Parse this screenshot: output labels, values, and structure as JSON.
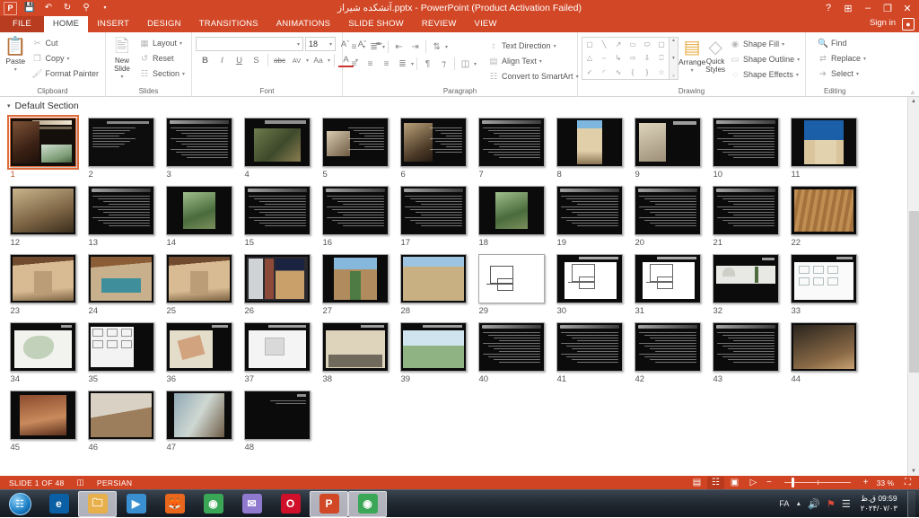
{
  "titlebar": {
    "app_icon": "powerpoint-icon",
    "quick_access": [
      {
        "name": "save-icon",
        "glyph": "💾"
      },
      {
        "name": "undo-icon",
        "glyph": "↶"
      },
      {
        "name": "redo-icon",
        "glyph": "↻"
      },
      {
        "name": "start-slideshow-icon",
        "glyph": "⛶"
      },
      {
        "name": "customize-qat-icon",
        "glyph": "▾"
      }
    ],
    "document_title": "آتشکده شیراز.pptx  -  PowerPoint (Product Activation Failed)",
    "window_controls": [
      {
        "name": "help-button",
        "glyph": "?"
      },
      {
        "name": "ribbon-display-options-button",
        "glyph": "⊞"
      },
      {
        "name": "minimize-button",
        "glyph": "–"
      },
      {
        "name": "restore-button",
        "glyph": "❐"
      },
      {
        "name": "close-button",
        "glyph": "✕"
      }
    ],
    "sign_in": "Sign in",
    "account_icon": "user-account-icon"
  },
  "tabs": [
    {
      "label": "FILE",
      "active": false,
      "file": true
    },
    {
      "label": "HOME",
      "active": true,
      "file": false
    },
    {
      "label": "INSERT",
      "active": false,
      "file": false
    },
    {
      "label": "DESIGN",
      "active": false,
      "file": false
    },
    {
      "label": "TRANSITIONS",
      "active": false,
      "file": false
    },
    {
      "label": "ANIMATIONS",
      "active": false,
      "file": false
    },
    {
      "label": "SLIDE SHOW",
      "active": false,
      "file": false
    },
    {
      "label": "REVIEW",
      "active": false,
      "file": false
    },
    {
      "label": "VIEW",
      "active": false,
      "file": false
    }
  ],
  "ribbon": {
    "clipboard": {
      "title": "Clipboard",
      "paste_label": "Paste",
      "items": [
        {
          "label": "Cut",
          "icon": "scissors-icon"
        },
        {
          "label": "Copy",
          "icon": "copy-icon"
        },
        {
          "label": "Format Painter",
          "icon": "format-painter-icon"
        }
      ]
    },
    "slides": {
      "title": "Slides",
      "new_slide_label": "New Slide",
      "items": [
        {
          "label": "Layout",
          "icon": "layout-icon"
        },
        {
          "label": "Reset",
          "icon": "reset-icon"
        },
        {
          "label": "Section",
          "icon": "section-icon"
        }
      ]
    },
    "font": {
      "title": "Font",
      "font_name_value": "",
      "font_name_placeholder": "",
      "font_size_value": "18",
      "buttons": [
        {
          "name": "increase-font-size-button",
          "label": "A˄"
        },
        {
          "name": "decrease-font-size-button",
          "label": "A˅"
        },
        {
          "name": "clear-formatting-button",
          "label": "✐"
        },
        {
          "name": "bold-button",
          "label": "B"
        },
        {
          "name": "italic-button",
          "label": "I"
        },
        {
          "name": "underline-button",
          "label": "U"
        },
        {
          "name": "text-shadow-button",
          "label": "S"
        },
        {
          "name": "strikethrough-button",
          "label": "abc"
        },
        {
          "name": "character-spacing-button",
          "label": "AV"
        },
        {
          "name": "change-case-button",
          "label": "Aa"
        },
        {
          "name": "font-color-button",
          "label": "A"
        }
      ]
    },
    "paragraph": {
      "title": "Paragraph",
      "items": [
        {
          "label": "Text Direction",
          "icon": "text-direction-icon"
        },
        {
          "label": "Align Text",
          "icon": "align-text-icon"
        },
        {
          "label": "Convert to SmartArt",
          "icon": "smartart-icon"
        }
      ],
      "row1": [
        "bullets-icon",
        "numbering-icon",
        "decrease-indent-icon",
        "increase-indent-icon",
        "line-spacing-icon"
      ],
      "row2": [
        "align-left-icon",
        "align-center-icon",
        "align-right-icon",
        "justify-icon",
        "rtl-direction-icon",
        "ltr-direction-icon",
        "columns-icon"
      ]
    },
    "drawing": {
      "title": "Drawing",
      "arrange_label": "Arrange",
      "quick_styles_label": "Quick Styles",
      "items": [
        {
          "label": "Shape Fill",
          "icon": "shape-fill-icon"
        },
        {
          "label": "Shape Outline",
          "icon": "shape-outline-icon"
        },
        {
          "label": "Shape Effects",
          "icon": "shape-effects-icon"
        }
      ],
      "shapes": [
        "▢",
        "╲",
        "↗",
        "▭",
        "⬭",
        "▢",
        "△",
        "⌐",
        "↳",
        "⇨",
        "⇩",
        "⌐",
        "⌘",
        "◜",
        "∿",
        "{",
        "}",
        "☆"
      ]
    },
    "editing": {
      "title": "Editing",
      "items": [
        {
          "label": "Find",
          "icon": "binoculars-icon"
        },
        {
          "label": "Replace",
          "icon": "replace-icon"
        },
        {
          "label": "Select",
          "icon": "select-cursor-icon"
        }
      ],
      "collapse_icon": "collapse-ribbon-icon"
    }
  },
  "sorter": {
    "section_name": "Default Section",
    "expand_icon": "triangle-collapse-icon",
    "selected_slide": 1,
    "slides": [
      {
        "n": 1,
        "kind": "title-image",
        "bg": "#1a1410"
      },
      {
        "n": 2,
        "kind": "text-left",
        "bg": "#0d0d0d"
      },
      {
        "n": 3,
        "kind": "text",
        "bg": "#0b0b0b"
      },
      {
        "n": 4,
        "kind": "image-mid",
        "bg": "#0b0b0b"
      },
      {
        "n": 5,
        "kind": "text-image",
        "bg": "#0b0b0b"
      },
      {
        "n": 6,
        "kind": "image-text",
        "bg": "#0b0b0b"
      },
      {
        "n": 7,
        "kind": "text",
        "bg": "#0b0b0b"
      },
      {
        "n": 8,
        "kind": "image-tall",
        "bg": "#0b0b0b"
      },
      {
        "n": 9,
        "kind": "image-doc",
        "bg": "#0b0b0b"
      },
      {
        "n": 10,
        "kind": "text",
        "bg": "#0b0b0b"
      },
      {
        "n": 11,
        "kind": "image-sky",
        "bg": "#0b0b0b"
      },
      {
        "n": 12,
        "kind": "image-wide",
        "bg": "#0b0b0b"
      },
      {
        "n": 13,
        "kind": "text",
        "bg": "#0b0b0b"
      },
      {
        "n": 14,
        "kind": "image-green",
        "bg": "#0b0b0b"
      },
      {
        "n": 15,
        "kind": "text",
        "bg": "#0b0b0b"
      },
      {
        "n": 16,
        "kind": "text",
        "bg": "#0b0b0b"
      },
      {
        "n": 17,
        "kind": "text",
        "bg": "#0b0b0b"
      },
      {
        "n": 18,
        "kind": "image-green",
        "bg": "#0b0b0b"
      },
      {
        "n": 19,
        "kind": "text",
        "bg": "#0b0b0b"
      },
      {
        "n": 20,
        "kind": "text",
        "bg": "#0b0b0b"
      },
      {
        "n": 21,
        "kind": "text",
        "bg": "#0b0b0b"
      },
      {
        "n": 22,
        "kind": "image-wood",
        "bg": "#0b0b0b"
      },
      {
        "n": 23,
        "kind": "image-room",
        "bg": "#0b0b0b"
      },
      {
        "n": 24,
        "kind": "image-bed",
        "bg": "#0b0b0b"
      },
      {
        "n": 25,
        "kind": "image-room",
        "bg": "#0b0b0b"
      },
      {
        "n": 26,
        "kind": "image-door",
        "bg": "#0b0b0b"
      },
      {
        "n": 27,
        "kind": "image-court",
        "bg": "#0b0b0b"
      },
      {
        "n": 28,
        "kind": "image-roof",
        "bg": "#0b0b0b"
      },
      {
        "n": 29,
        "kind": "plan-white",
        "bg": "#ffffff"
      },
      {
        "n": 30,
        "kind": "plan-dark",
        "bg": "#0b0b0b"
      },
      {
        "n": 31,
        "kind": "plan-dark",
        "bg": "#0b0b0b"
      },
      {
        "n": 32,
        "kind": "section-dark",
        "bg": "#0b0b0b"
      },
      {
        "n": 33,
        "kind": "diagram",
        "bg": "#0b0b0b"
      },
      {
        "n": 34,
        "kind": "map-white",
        "bg": "#0b0b0b"
      },
      {
        "n": 35,
        "kind": "grid-dark",
        "bg": "#0b0b0b"
      },
      {
        "n": 36,
        "kind": "map-color",
        "bg": "#0b0b0b"
      },
      {
        "n": 37,
        "kind": "plan-white2",
        "bg": "#0b0b0b"
      },
      {
        "n": 38,
        "kind": "sketch",
        "bg": "#0b0b0b"
      },
      {
        "n": 39,
        "kind": "render-green",
        "bg": "#0b0b0b"
      },
      {
        "n": 40,
        "kind": "text",
        "bg": "#0b0b0b"
      },
      {
        "n": 41,
        "kind": "text",
        "bg": "#0b0b0b"
      },
      {
        "n": 42,
        "kind": "text",
        "bg": "#0b0b0b"
      },
      {
        "n": 43,
        "kind": "text",
        "bg": "#0b0b0b"
      },
      {
        "n": 44,
        "kind": "image-int",
        "bg": "#0b0b0b"
      },
      {
        "n": 45,
        "kind": "image-warm",
        "bg": "#0b0b0b"
      },
      {
        "n": 46,
        "kind": "image-loft",
        "bg": "#0b0b0b"
      },
      {
        "n": 47,
        "kind": "image-glass",
        "bg": "#0b0b0b"
      },
      {
        "n": 48,
        "kind": "text-dark",
        "bg": "#0b0b0b"
      }
    ]
  },
  "status": {
    "slide_counter": "SLIDE 1 OF 48",
    "notes_icon": "notes-icon",
    "language": "PERSIAN",
    "views": [
      {
        "name": "normal-view-button",
        "glyph": "▤",
        "active": false
      },
      {
        "name": "slide-sorter-view-button",
        "glyph": "☷",
        "active": true
      },
      {
        "name": "reading-view-button",
        "glyph": "▣",
        "active": false
      },
      {
        "name": "slideshow-view-button",
        "glyph": "▷",
        "active": false
      }
    ],
    "zoom_out": "−",
    "zoom_in": "+",
    "zoom_level": "33 %",
    "fit_window_icon": "fit-to-window-icon"
  },
  "taskbar": {
    "start_icon": "windows-start-orb",
    "items": [
      {
        "name": "internet-explorer-icon",
        "glyph": "e",
        "color": "#0b5fa4",
        "active": false
      },
      {
        "name": "file-explorer-icon",
        "glyph": "🗀",
        "color": "#e8b04b",
        "active": true
      },
      {
        "name": "media-player-icon",
        "glyph": "▶",
        "color": "#3a8fd0",
        "active": false
      },
      {
        "name": "firefox-icon",
        "glyph": "🦊",
        "color": "#e8671c",
        "active": false
      },
      {
        "name": "chrome-icon",
        "glyph": "◉",
        "color": "#3aa757",
        "active": false
      },
      {
        "name": "mail-icon",
        "glyph": "✉",
        "color": "#8f7ad0",
        "active": false
      },
      {
        "name": "opera-icon",
        "glyph": "O",
        "color": "#d0102a",
        "active": false
      },
      {
        "name": "powerpoint-taskbar-icon",
        "glyph": "P",
        "color": "#d24726",
        "active": true
      },
      {
        "name": "chrome-window-icon",
        "glyph": "◉",
        "color": "#3aa757",
        "active": true
      }
    ],
    "tray": {
      "language": "FA",
      "show_hidden_icon": "show-hidden-icons-chevron",
      "volume_icon": "volume-icon",
      "action_center_icon": "flag-icon",
      "network_icon": "network-signal-icon",
      "clock_time": "09:59 ق.ظ",
      "clock_date": "۲۰۲۴/۰۷/۰۳"
    },
    "show_desktop": "show-desktop-button"
  }
}
